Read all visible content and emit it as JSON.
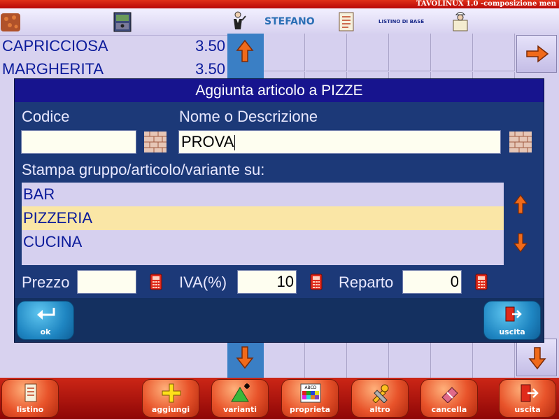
{
  "app": {
    "title": "TAVOLINUX 1.0 -composizione men"
  },
  "toolbar": {
    "waiter_name": "STEFANO",
    "listino_label": "LISTINO DI BASE"
  },
  "products": [
    {
      "name": "CAPRICCIOSA",
      "price": "3.50"
    },
    {
      "name": "MARGHERITA",
      "price": "3.50"
    }
  ],
  "dialog": {
    "title": "Aggiunta articolo a PIZZE",
    "codice_label": "Codice",
    "codice_value": "",
    "nome_label": "Nome o Descrizione",
    "nome_value": "PROVA",
    "stampa_label": "Stampa gruppo/articolo/variante su:",
    "printers": [
      "BAR",
      "PIZZERIA",
      "CUCINA"
    ],
    "selected_printer": "PIZZERIA",
    "prezzo_label": "Prezzo",
    "prezzo_value": "",
    "iva_label": "IVA(%)",
    "iva_value": "10",
    "reparto_label": "Reparto",
    "reparto_value": "0",
    "ok_label": "ok",
    "uscita_label": "uscita"
  },
  "bottombar": {
    "listino": "listino",
    "aggiungi": "aggiungi",
    "varianti": "varianti",
    "proprieta": "proprieta",
    "altro": "altro",
    "cancella": "cancella",
    "uscita": "uscita"
  },
  "icons": {
    "accent_orange": "#e8532a",
    "arrow_orange": "#f06a1a",
    "dialog_blue": "#1c3978",
    "title_blue": "#17148e",
    "selected_row": "#fae6a6"
  }
}
